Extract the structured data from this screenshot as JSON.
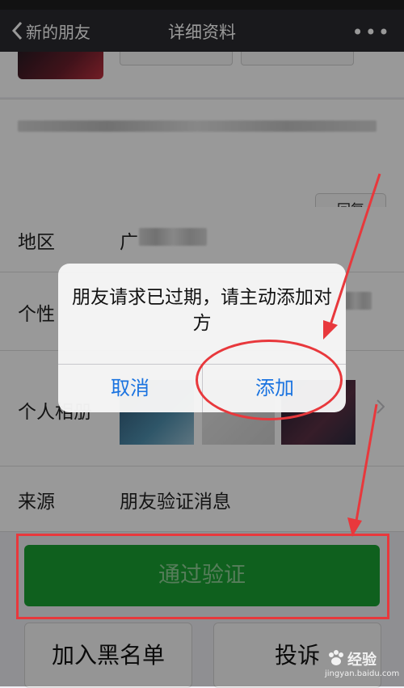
{
  "nav": {
    "back_label": "新的朋友",
    "title": "详细资料",
    "more_icon": "more-icon"
  },
  "profile": {
    "reply_label": "回复"
  },
  "rows": {
    "region": {
      "label": "地区",
      "value": "广"
    },
    "signature": {
      "label": "个性"
    },
    "album": {
      "label": "个人相册"
    },
    "source": {
      "label": "来源",
      "value": "朋友验证消息"
    }
  },
  "dialog": {
    "message": "朋友请求已过期，请主动添加对方",
    "cancel_label": "取消",
    "add_label": "添加"
  },
  "actions": {
    "verify_label": "通过验证",
    "blacklist_label": "加入黑名单",
    "report_label": "投诉"
  },
  "watermark": {
    "brand": "经验",
    "site": "jingyan.baidu.com"
  },
  "colors": {
    "accent_green": "#1aa033",
    "dialog_blue": "#1a73e0",
    "annotation_red": "#e8383c"
  }
}
